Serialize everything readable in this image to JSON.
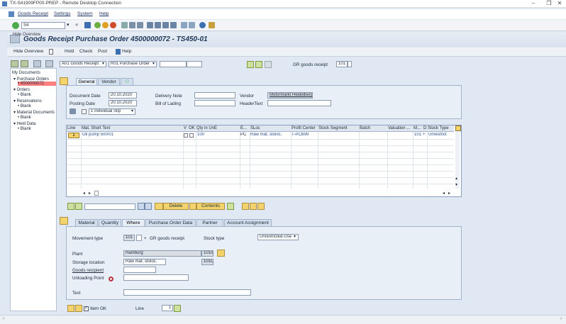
{
  "window": {
    "title": "TX-S41909FP00-PREP - Remote Desktop Connection",
    "minimize": "–",
    "restore": "❐",
    "close": "✕"
  },
  "menu": [
    "Goods Receipt",
    "Settings",
    "System",
    "Help"
  ],
  "toolbar": {
    "command_value": "S4"
  },
  "page": {
    "title": "Goods Receipt Purchase Order 4500000072 - TS450-01",
    "hover_tooltip": "Hide Overview"
  },
  "app_toolbar": {
    "hide_overview": "Hide Overview",
    "hold": "Hold",
    "check": "Check",
    "post": "Post",
    "help": "Help"
  },
  "header_fields": {
    "transaction": "A01 Goods Receipt",
    "reference": "R01 Purchase Order",
    "mvt_label": "GR goods receipt",
    "mvt_type": "101"
  },
  "nav": {
    "root": "My Documents",
    "items": [
      {
        "label": "▾ Purchase Orders",
        "level": 0
      },
      {
        "label": "• 4500000072",
        "level": 1,
        "selected": true
      },
      {
        "label": "▾ Orders",
        "level": 0
      },
      {
        "label": "• Blank",
        "level": 1
      },
      {
        "label": "▾ Reservations",
        "level": 0
      },
      {
        "label": "• Blank",
        "level": 1
      },
      {
        "label": "▾ Material Documents",
        "level": 0
      },
      {
        "label": "• Blank",
        "level": 1
      },
      {
        "label": "▾ Held Data",
        "level": 0
      },
      {
        "label": "• Blank",
        "level": 1
      }
    ]
  },
  "header_tabs": [
    "General",
    "Vendor"
  ],
  "general": {
    "document_date_label": "Document Date",
    "document_date": "20.10.2020",
    "posting_date_label": "Posting Date",
    "posting_date": "20.10.2020",
    "delivery_note_label": "Delivery Note",
    "delivery_note": "",
    "bill_of_lading_label": "Bill of Lading",
    "bill_of_lading": "",
    "vendor_label": "Vendor",
    "vendor": "Motormarkt Heidelberg",
    "header_text_label": "HeaderText",
    "header_text": "",
    "slip_value": "1 Individual Slip"
  },
  "items_table": {
    "columns": [
      "Line",
      "Mat. Short Text",
      "V",
      "OK",
      "Qty in UnE",
      "E...",
      "SLoc",
      "Profit Center",
      "Stock Segment",
      "Batch",
      "Valuation ...",
      "M...",
      "D",
      "Stock Type"
    ],
    "rows": [
      {
        "line": "1",
        "text": "Oil pump 500/01",
        "qty": "100",
        "unit": "PC",
        "sloc": "Raw mat. stoloc.",
        "profit_center": "T-PCB99",
        "mvt": "101",
        "d": "+",
        "stock_type": "Unrestrict"
      }
    ]
  },
  "table_buttons": {
    "delete": "Delete",
    "contents": "Contents"
  },
  "detail_tabs": [
    "Material",
    "Quantity",
    "Where",
    "Purchase Order Data",
    "Partner",
    "Account Assignment"
  ],
  "where": {
    "movement_type_label": "Movement type",
    "movement_type": "101",
    "movement_sign": "+",
    "movement_text": "GR goods receipt",
    "stock_type_label": "Stock type",
    "stock_type": "Unrestricted-Use",
    "plant_label": "Plant",
    "plant": "Hamburg",
    "plant_code": "1010",
    "storage_location_label": "Storage location",
    "storage_location": "Raw mat. stoloc.",
    "storage_code": "101C",
    "goods_recipient_label": "Goods recipient",
    "goods_recipient": "",
    "unloading_point_label": "Unloading Point",
    "unloading_point": "",
    "text_label": "Text",
    "text": ""
  },
  "footer": {
    "item_ok": "Item OK",
    "line_label": "Line",
    "line_value": "1"
  }
}
